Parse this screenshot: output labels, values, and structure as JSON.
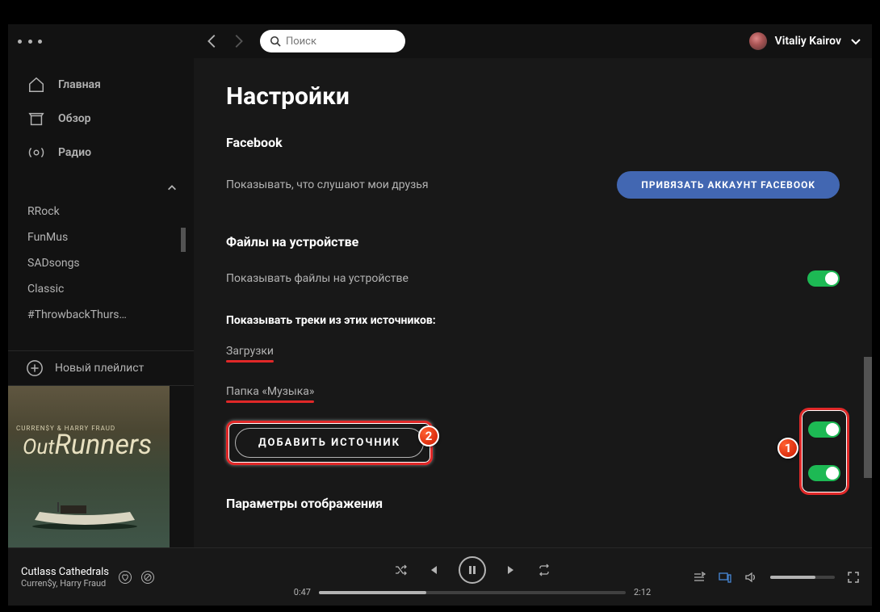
{
  "window": {
    "minimize": "—",
    "maximize": "▢",
    "close": "✕"
  },
  "topbar": {
    "search_placeholder": "Поиск",
    "user_name": "Vitaliy Kairov"
  },
  "sidebar": {
    "nav": [
      {
        "label": "Главная",
        "icon": "home-icon"
      },
      {
        "label": "Обзор",
        "icon": "browse-icon"
      },
      {
        "label": "Радио",
        "icon": "radio-icon"
      }
    ],
    "playlists": [
      "RRock",
      "FunMus",
      "SADsongs",
      "Classic",
      "#ThrowbackThurs…"
    ],
    "new_playlist": "Новый плейлист",
    "album": {
      "credits": "CURREN$Y & HARRY FRAUD",
      "title_prefix": "Out",
      "title_main": "Runners"
    }
  },
  "settings": {
    "heading": "Настройки",
    "facebook": {
      "title": "Facebook",
      "desc": "Показывать, что слушают мои друзья",
      "button": "ПРИВЯЗАТЬ АККАУНТ FACEBOOK"
    },
    "local_files": {
      "title": "Файлы на устройстве",
      "show_label": "Показывать файлы на устройстве",
      "sources_header": "Показывать треки из этих источников:",
      "sources": [
        {
          "label": "Загрузки",
          "on": true
        },
        {
          "label": "Папка «Музыка»",
          "on": true
        }
      ],
      "add_source": "ДОБАВИТЬ ИСТОЧНИК"
    },
    "display": {
      "title": "Параметры отображения"
    }
  },
  "callouts": {
    "one": "1",
    "two": "2"
  },
  "player": {
    "track": "Cutlass Cathedrals",
    "artist": "Curren$y, Harry Fraud",
    "elapsed": "0:47",
    "total": "2:12"
  },
  "colors": {
    "accent": "#1db954",
    "facebook": "#4267B2",
    "highlight": "#e02828"
  }
}
